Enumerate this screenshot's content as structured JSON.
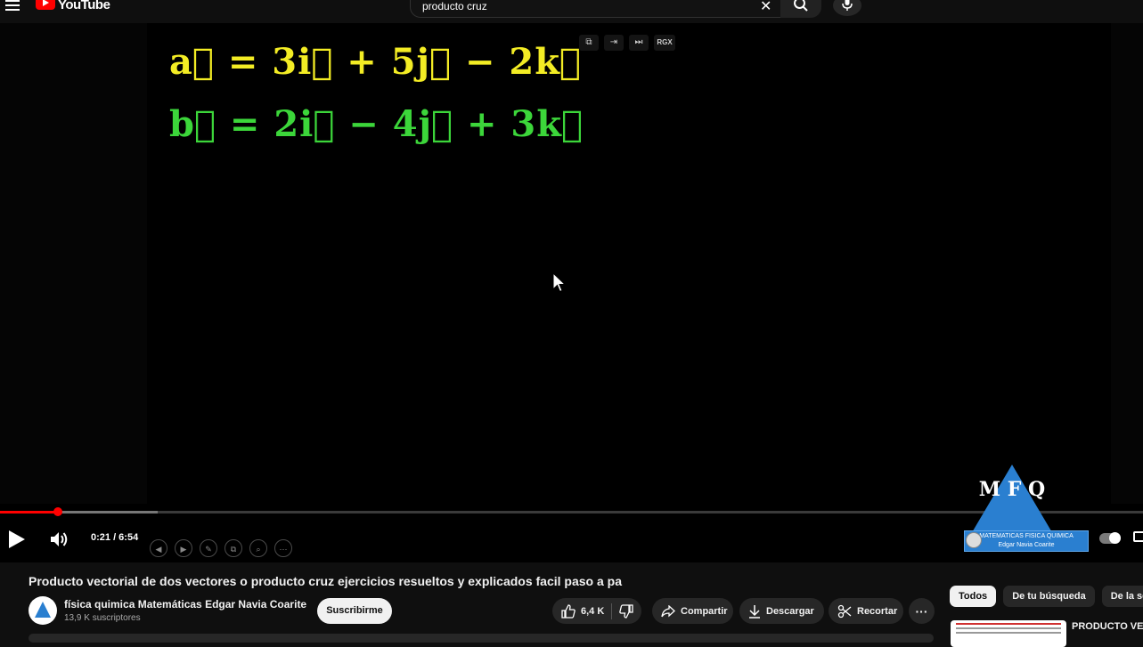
{
  "header": {
    "logo_text": "YouTube",
    "search_value": "producto cruz"
  },
  "player": {
    "equation_a": "a⃗ = 3i⃗ + 5j⃗ − 2k⃗",
    "equation_b": "b⃗ = 2i⃗ − 4j⃗ + 3k⃗",
    "equation_a_color": "#f3ec24",
    "equation_b_color": "#3cd63a",
    "ext_toolbar_label": "RGX",
    "time_display": "0:21 / 6:54",
    "progress_played_fraction": 0.051,
    "progress_buffered_fraction": 0.138,
    "watermark": {
      "letters": "M F Q",
      "line1": "MATEMATICAS  FISICA QUIMICA",
      "line2": "Edgar Navia Coarite"
    }
  },
  "video": {
    "title": "Producto vectorial de dos vectores o producto cruz ejercicios resueltos y explicados facil paso a pa",
    "channel_name": "física quimica Matemáticas Edgar Navia Coarite",
    "subscribers": "13,9 K suscriptores",
    "subscribe_label": "Suscribirme",
    "likes": "6,4 K",
    "share_label": "Compartir",
    "download_label": "Descargar",
    "clip_label": "Recortar",
    "more_label": "···"
  },
  "sidebar": {
    "chips": [
      "Todos",
      "De tu búsqueda",
      "De la serie"
    ],
    "rec_title": "PRODUCTO VEC PRODUCTO CRU"
  },
  "colors": {
    "accent": "#ff0000",
    "background": "#0f0f0f",
    "brand_blue": "#2a7fd0"
  }
}
